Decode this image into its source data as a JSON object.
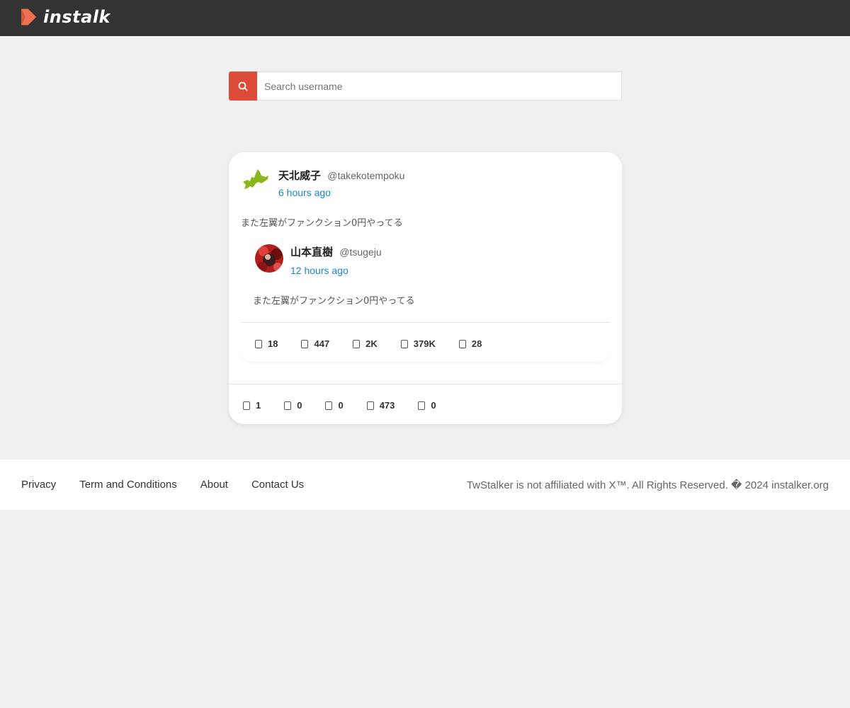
{
  "header": {
    "brand": "instalk"
  },
  "search": {
    "placeholder": "Search username",
    "icon": "search-icon"
  },
  "post": {
    "author_name": "天北威子",
    "author_handle": "@takekotempoku",
    "time": "6 hours ago",
    "text": "また左翼がファンクション0円やってる",
    "quoted": {
      "author_name": "山本直樹",
      "author_handle": "@tsugeju",
      "time": "12 hours ago",
      "text": "また左翼がファンクション0円やってる",
      "stats": [
        "18",
        "447",
        "2K",
        "379K",
        "28"
      ]
    },
    "stats": [
      "1",
      "0",
      "0",
      "473",
      "0"
    ]
  },
  "footer": {
    "links": [
      "Privacy",
      "Term and Conditions",
      "About",
      "Contact Us"
    ],
    "copyright": "TwStalker is not affiliated with X™. All Rights Reserved. � 2024 instalker.org"
  },
  "colors": {
    "topbar": "#333333",
    "accent": "#dd4b39",
    "link": "#1a86d0",
    "logo": "#f07050"
  }
}
